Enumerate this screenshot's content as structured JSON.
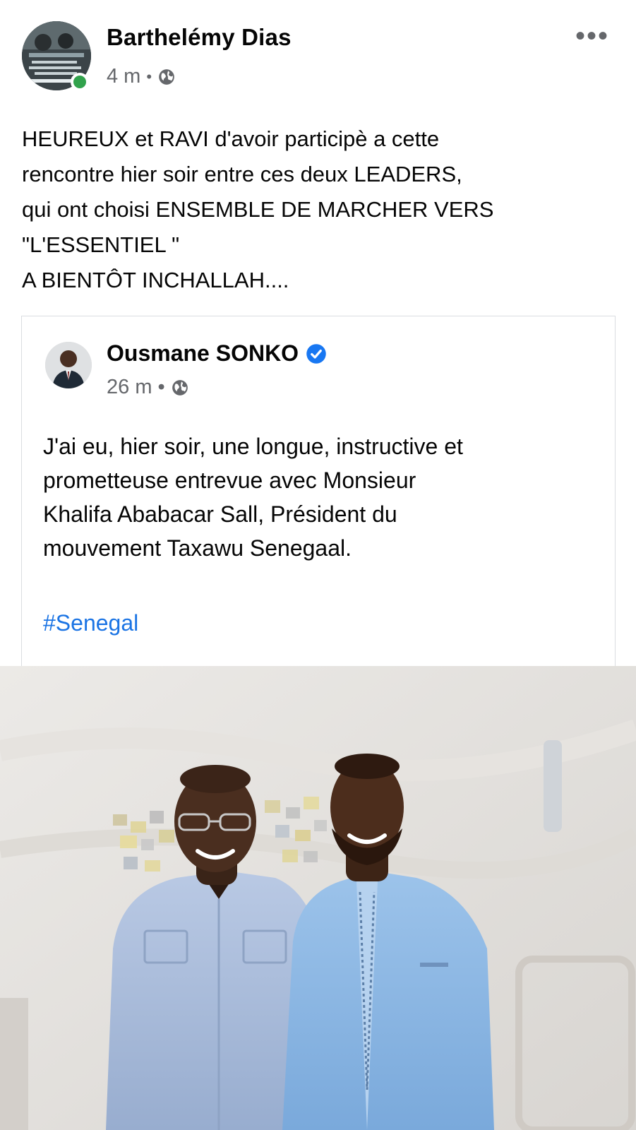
{
  "post": {
    "author": "Barthelémy Dias",
    "time": "4 m",
    "separator": "•",
    "more_label": "•••",
    "lines": [
      "HEUREUX et RAVI d'avoir participè a cette",
      "rencontre hier soir entre ces deux LEADERS,",
      "qui ont choisi ENSEMBLE DE MARCHER VERS",
      "\"L'ESSENTIEL \"",
      "A BIENTÔT INCHALLAH...."
    ]
  },
  "shared": {
    "author": "Ousmane SONKO",
    "time": "26 m",
    "separator": "•",
    "lines": [
      "J'ai eu, hier soir, une longue, instructive et",
      "prometteuse entrevue avec Monsieur",
      "Khalifa Ababacar Sall, Président du",
      "mouvement Taxawu Senegaal."
    ],
    "hashtag": "#Senegal"
  },
  "icons": {
    "audience": "globe-icon",
    "verified": "verified-badge-icon",
    "more": "more-options-icon"
  },
  "colors": {
    "link": "#1b74e4",
    "online": "#31a24c",
    "meta": "#65676b",
    "verified": "#1877f2"
  }
}
